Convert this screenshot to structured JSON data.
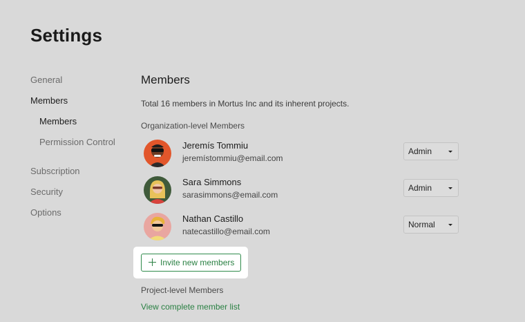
{
  "page": {
    "title": "Settings"
  },
  "sidebar": {
    "items": [
      {
        "label": "General",
        "active": false
      },
      {
        "label": "Members",
        "active": true
      },
      {
        "label": "Members",
        "active": true,
        "sub": true
      },
      {
        "label": "Permission Control",
        "active": false,
        "sub": true
      },
      {
        "label": "Subscription",
        "active": false
      },
      {
        "label": "Security",
        "active": false
      },
      {
        "label": "Options",
        "active": false
      }
    ]
  },
  "main": {
    "section_title": "Members",
    "summary": "Total 16 members in Mortus Inc and its inherent projects.",
    "org_label": "Organization-level Members",
    "members": [
      {
        "name": "Jeremís Tommiu",
        "email": "jeremístommiu@email.com",
        "role": "Admin"
      },
      {
        "name": "Sara Simmons",
        "email": "sarasimmons@email.com",
        "role": "Admin"
      },
      {
        "name": "Nathan Castillo",
        "email": "natecastillo@email.com",
        "role": "Normal"
      }
    ],
    "invite_label": "Invite new members",
    "project_label": "Project-level Members",
    "view_list_label": "View complete member list"
  },
  "colors": {
    "background": "#d9d9d9",
    "accent_green": "#2a8043",
    "highlight": "#ffffff"
  }
}
